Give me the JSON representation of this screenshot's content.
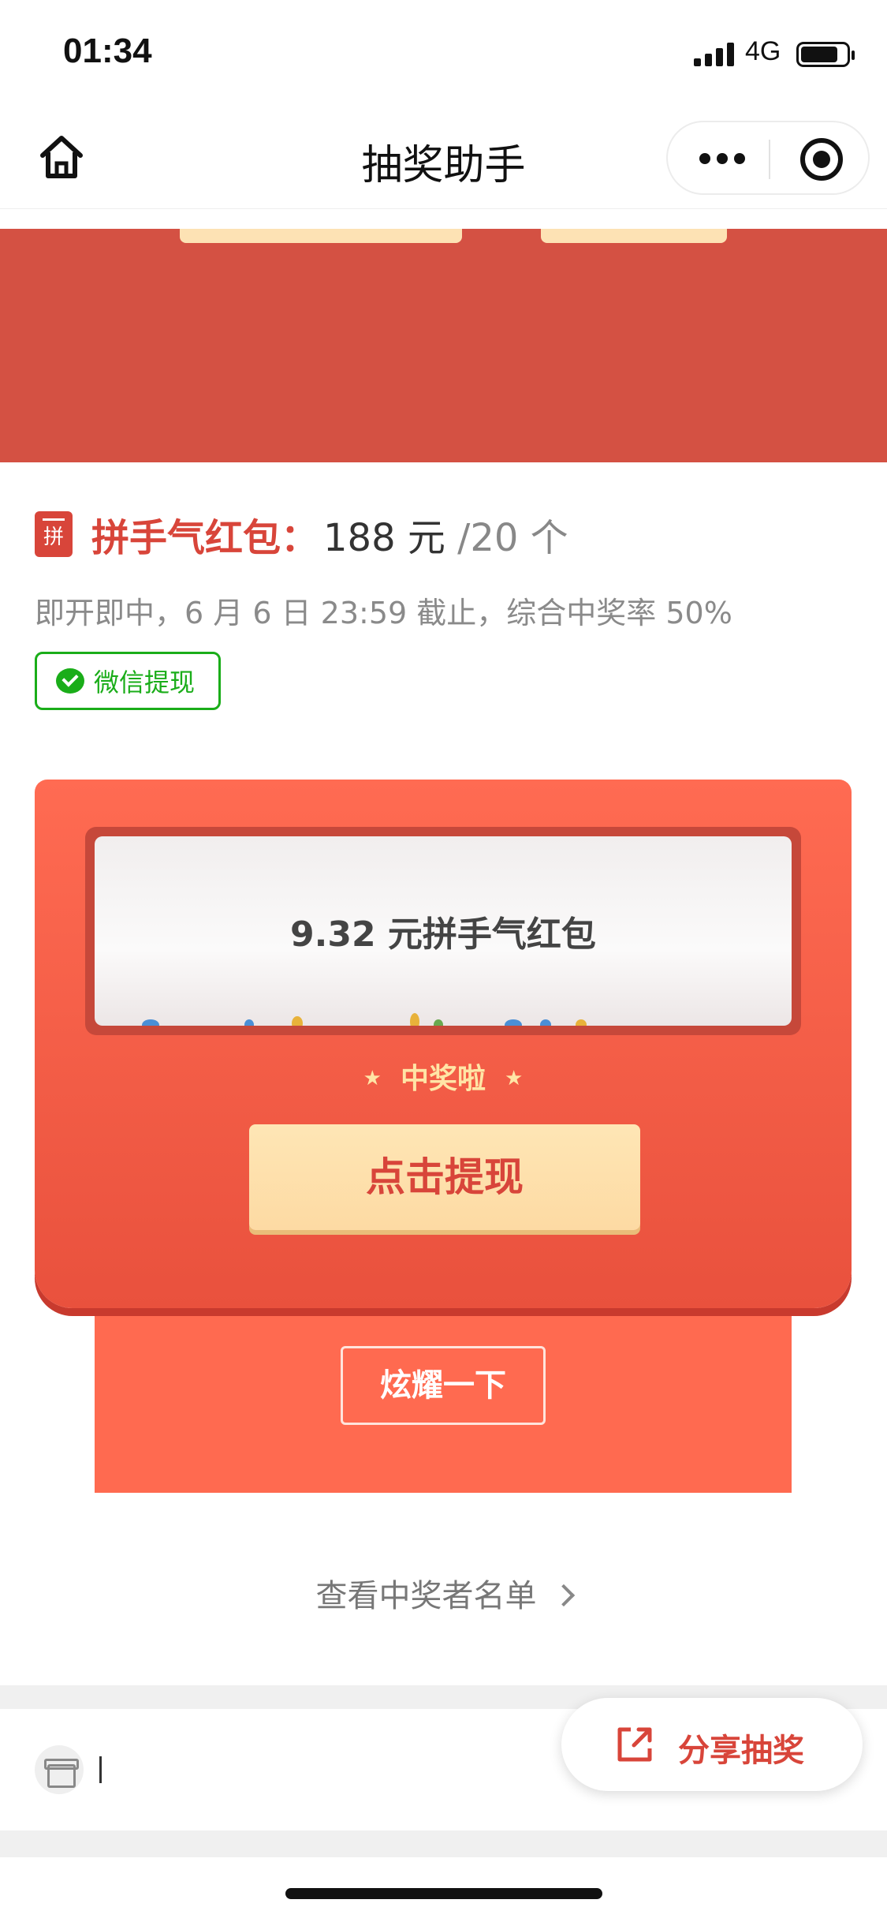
{
  "status_bar": {
    "time": "01:34",
    "network": "4G"
  },
  "nav": {
    "title": "抽奖助手"
  },
  "prize": {
    "icon_text": "拼",
    "kind": "拼手气红包：",
    "amount": "188 元",
    "count": "/20 个",
    "subtitle": "即开即中，6 月 6 日 23:59 截止，综合中奖率 50%",
    "badge": "微信提现"
  },
  "envelope": {
    "paper_text": "9.32 元拼手气红包",
    "win_text": "中奖啦",
    "star": "★",
    "withdraw_label": "点击提现",
    "show_off_label": "炫耀一下"
  },
  "winners_link": "查看中奖者名单",
  "share": {
    "label": "分享抽奖"
  },
  "footer_peek": "",
  "colors": {
    "brand_red": "#d8453a",
    "wechat_green": "#1aad19",
    "button_cream": "#fde2b4"
  },
  "icons": [
    "home-icon",
    "more-dots-icon",
    "target-icon",
    "wechat-icon",
    "gift-icon",
    "share-icon",
    "chevron-right-icon"
  ]
}
